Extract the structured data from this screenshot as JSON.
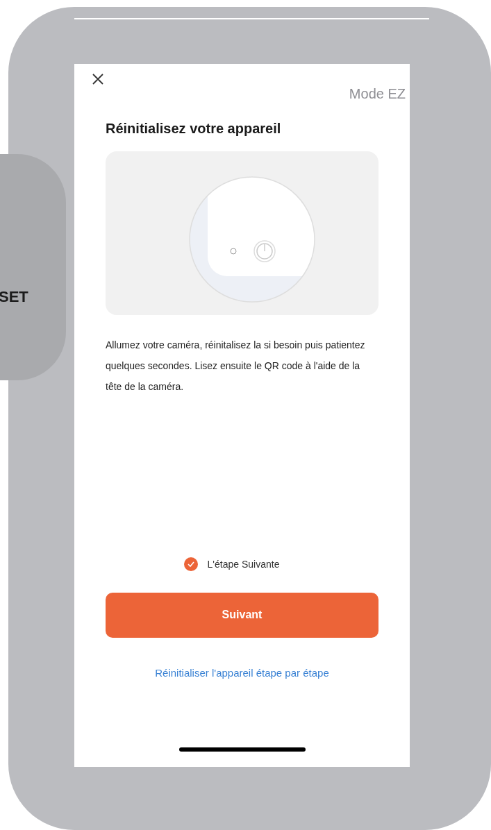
{
  "side_tab": {
    "label": "SET"
  },
  "header": {
    "mode_label": "Mode EZ"
  },
  "title": "Réinitialisez votre appareil",
  "description": "Allumez votre caméra, réinitalisez la si besoin puis patientez quelques secondes. Lisez ensuite le QR code à l'aide de la tête de la caméra.",
  "confirm": {
    "label": "L'étape Suivante",
    "checked": true
  },
  "primary_button": {
    "label": "Suivant"
  },
  "link": {
    "label": "Réinitialiser l'appareil étape par étape"
  }
}
